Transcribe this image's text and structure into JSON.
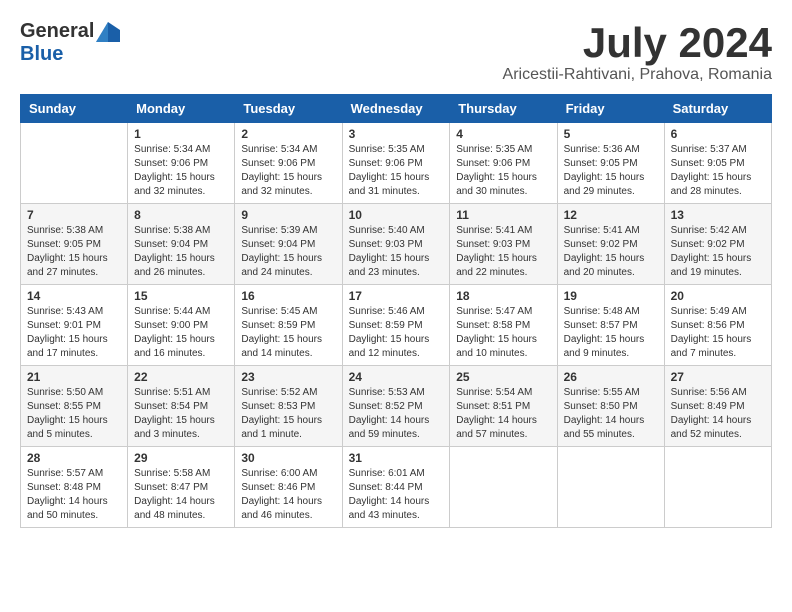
{
  "header": {
    "logo_general": "General",
    "logo_blue": "Blue",
    "month_year": "July 2024",
    "location": "Aricestii-Rahtivani, Prahova, Romania"
  },
  "calendar": {
    "days_of_week": [
      "Sunday",
      "Monday",
      "Tuesday",
      "Wednesday",
      "Thursday",
      "Friday",
      "Saturday"
    ],
    "weeks": [
      [
        {
          "day": "",
          "info": ""
        },
        {
          "day": "1",
          "info": "Sunrise: 5:34 AM\nSunset: 9:06 PM\nDaylight: 15 hours\nand 32 minutes."
        },
        {
          "day": "2",
          "info": "Sunrise: 5:34 AM\nSunset: 9:06 PM\nDaylight: 15 hours\nand 32 minutes."
        },
        {
          "day": "3",
          "info": "Sunrise: 5:35 AM\nSunset: 9:06 PM\nDaylight: 15 hours\nand 31 minutes."
        },
        {
          "day": "4",
          "info": "Sunrise: 5:35 AM\nSunset: 9:06 PM\nDaylight: 15 hours\nand 30 minutes."
        },
        {
          "day": "5",
          "info": "Sunrise: 5:36 AM\nSunset: 9:05 PM\nDaylight: 15 hours\nand 29 minutes."
        },
        {
          "day": "6",
          "info": "Sunrise: 5:37 AM\nSunset: 9:05 PM\nDaylight: 15 hours\nand 28 minutes."
        }
      ],
      [
        {
          "day": "7",
          "info": "Sunrise: 5:38 AM\nSunset: 9:05 PM\nDaylight: 15 hours\nand 27 minutes."
        },
        {
          "day": "8",
          "info": "Sunrise: 5:38 AM\nSunset: 9:04 PM\nDaylight: 15 hours\nand 26 minutes."
        },
        {
          "day": "9",
          "info": "Sunrise: 5:39 AM\nSunset: 9:04 PM\nDaylight: 15 hours\nand 24 minutes."
        },
        {
          "day": "10",
          "info": "Sunrise: 5:40 AM\nSunset: 9:03 PM\nDaylight: 15 hours\nand 23 minutes."
        },
        {
          "day": "11",
          "info": "Sunrise: 5:41 AM\nSunset: 9:03 PM\nDaylight: 15 hours\nand 22 minutes."
        },
        {
          "day": "12",
          "info": "Sunrise: 5:41 AM\nSunset: 9:02 PM\nDaylight: 15 hours\nand 20 minutes."
        },
        {
          "day": "13",
          "info": "Sunrise: 5:42 AM\nSunset: 9:02 PM\nDaylight: 15 hours\nand 19 minutes."
        }
      ],
      [
        {
          "day": "14",
          "info": "Sunrise: 5:43 AM\nSunset: 9:01 PM\nDaylight: 15 hours\nand 17 minutes."
        },
        {
          "day": "15",
          "info": "Sunrise: 5:44 AM\nSunset: 9:00 PM\nDaylight: 15 hours\nand 16 minutes."
        },
        {
          "day": "16",
          "info": "Sunrise: 5:45 AM\nSunset: 8:59 PM\nDaylight: 15 hours\nand 14 minutes."
        },
        {
          "day": "17",
          "info": "Sunrise: 5:46 AM\nSunset: 8:59 PM\nDaylight: 15 hours\nand 12 minutes."
        },
        {
          "day": "18",
          "info": "Sunrise: 5:47 AM\nSunset: 8:58 PM\nDaylight: 15 hours\nand 10 minutes."
        },
        {
          "day": "19",
          "info": "Sunrise: 5:48 AM\nSunset: 8:57 PM\nDaylight: 15 hours\nand 9 minutes."
        },
        {
          "day": "20",
          "info": "Sunrise: 5:49 AM\nSunset: 8:56 PM\nDaylight: 15 hours\nand 7 minutes."
        }
      ],
      [
        {
          "day": "21",
          "info": "Sunrise: 5:50 AM\nSunset: 8:55 PM\nDaylight: 15 hours\nand 5 minutes."
        },
        {
          "day": "22",
          "info": "Sunrise: 5:51 AM\nSunset: 8:54 PM\nDaylight: 15 hours\nand 3 minutes."
        },
        {
          "day": "23",
          "info": "Sunrise: 5:52 AM\nSunset: 8:53 PM\nDaylight: 15 hours\nand 1 minute."
        },
        {
          "day": "24",
          "info": "Sunrise: 5:53 AM\nSunset: 8:52 PM\nDaylight: 14 hours\nand 59 minutes."
        },
        {
          "day": "25",
          "info": "Sunrise: 5:54 AM\nSunset: 8:51 PM\nDaylight: 14 hours\nand 57 minutes."
        },
        {
          "day": "26",
          "info": "Sunrise: 5:55 AM\nSunset: 8:50 PM\nDaylight: 14 hours\nand 55 minutes."
        },
        {
          "day": "27",
          "info": "Sunrise: 5:56 AM\nSunset: 8:49 PM\nDaylight: 14 hours\nand 52 minutes."
        }
      ],
      [
        {
          "day": "28",
          "info": "Sunrise: 5:57 AM\nSunset: 8:48 PM\nDaylight: 14 hours\nand 50 minutes."
        },
        {
          "day": "29",
          "info": "Sunrise: 5:58 AM\nSunset: 8:47 PM\nDaylight: 14 hours\nand 48 minutes."
        },
        {
          "day": "30",
          "info": "Sunrise: 6:00 AM\nSunset: 8:46 PM\nDaylight: 14 hours\nand 46 minutes."
        },
        {
          "day": "31",
          "info": "Sunrise: 6:01 AM\nSunset: 8:44 PM\nDaylight: 14 hours\nand 43 minutes."
        },
        {
          "day": "",
          "info": ""
        },
        {
          "day": "",
          "info": ""
        },
        {
          "day": "",
          "info": ""
        }
      ]
    ]
  }
}
